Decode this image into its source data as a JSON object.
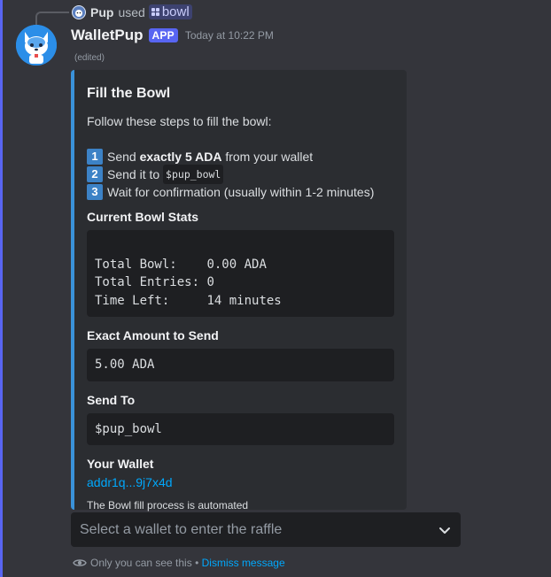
{
  "reply": {
    "user": "Pup",
    "verb": "used",
    "command": "bowl"
  },
  "message": {
    "username": "WalletPup",
    "badge": "APP",
    "timestamp": "Today at 10:22 PM",
    "edited": "(edited)"
  },
  "embed": {
    "accent_color": "#3a92d9",
    "title": "Fill the Bowl",
    "intro": "Follow these steps to fill the bowl:",
    "steps": [
      {
        "num": "1",
        "pre": "Send ",
        "bold": "exactly 5 ADA",
        "post": " from your wallet"
      },
      {
        "num": "2",
        "pre": "Send it to ",
        "code": "$pup_bowl"
      },
      {
        "num": "3",
        "text": "Wait for confirmation (usually within 1-2 minutes)"
      }
    ],
    "stats": {
      "name": "Current Bowl Stats",
      "rows": [
        {
          "label": "Total Bowl:    ",
          "value": "0.00 ADA"
        },
        {
          "label": "Total Entries: ",
          "value": "0"
        },
        {
          "label": "Time Left:     ",
          "value": "14 minutes"
        }
      ]
    },
    "amount": {
      "name": "Exact Amount to Send",
      "value": "5.00 ADA"
    },
    "send_to": {
      "name": "Send To",
      "value": "$pup_bowl"
    },
    "wallet": {
      "name": "Your Wallet",
      "value": "addr1q...9j7x4d"
    },
    "footer": "The Bowl fill process is automated"
  },
  "select": {
    "placeholder": "Select a wallet to enter the raffle",
    "icon": "chevron-down-icon"
  },
  "ephemeral": {
    "note": "Only you can see this",
    "separator": " • ",
    "dismiss": "Dismiss message",
    "icon": "eye-icon"
  }
}
